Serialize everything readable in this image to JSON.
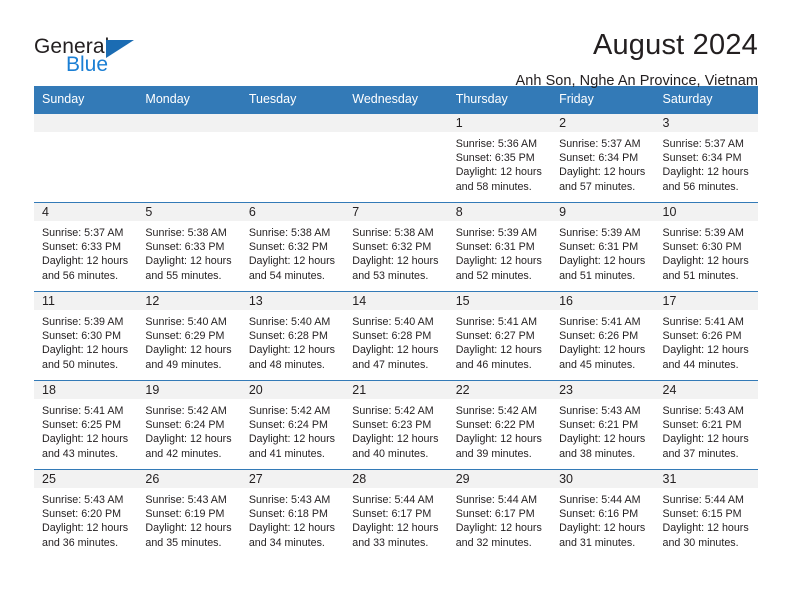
{
  "brand": {
    "name_top": "General",
    "name_bottom": "Blue",
    "accent_color": "#1b7fd4",
    "header_color": "#337ab7"
  },
  "header": {
    "title": "August 2024",
    "subtitle": "Anh Son, Nghe An Province, Vietnam"
  },
  "weekday_headers": [
    "Sunday",
    "Monday",
    "Tuesday",
    "Wednesday",
    "Thursday",
    "Friday",
    "Saturday"
  ],
  "weeks": [
    [
      {
        "day": "",
        "empty": true,
        "lines": []
      },
      {
        "day": "",
        "empty": true,
        "lines": []
      },
      {
        "day": "",
        "empty": true,
        "lines": []
      },
      {
        "day": "",
        "empty": true,
        "lines": []
      },
      {
        "day": "1",
        "empty": false,
        "lines": [
          "Sunrise: 5:36 AM",
          "Sunset: 6:35 PM",
          "Daylight: 12 hours",
          "and 58 minutes."
        ]
      },
      {
        "day": "2",
        "empty": false,
        "lines": [
          "Sunrise: 5:37 AM",
          "Sunset: 6:34 PM",
          "Daylight: 12 hours",
          "and 57 minutes."
        ]
      },
      {
        "day": "3",
        "empty": false,
        "lines": [
          "Sunrise: 5:37 AM",
          "Sunset: 6:34 PM",
          "Daylight: 12 hours",
          "and 56 minutes."
        ]
      }
    ],
    [
      {
        "day": "4",
        "empty": false,
        "lines": [
          "Sunrise: 5:37 AM",
          "Sunset: 6:33 PM",
          "Daylight: 12 hours",
          "and 56 minutes."
        ]
      },
      {
        "day": "5",
        "empty": false,
        "lines": [
          "Sunrise: 5:38 AM",
          "Sunset: 6:33 PM",
          "Daylight: 12 hours",
          "and 55 minutes."
        ]
      },
      {
        "day": "6",
        "empty": false,
        "lines": [
          "Sunrise: 5:38 AM",
          "Sunset: 6:32 PM",
          "Daylight: 12 hours",
          "and 54 minutes."
        ]
      },
      {
        "day": "7",
        "empty": false,
        "lines": [
          "Sunrise: 5:38 AM",
          "Sunset: 6:32 PM",
          "Daylight: 12 hours",
          "and 53 minutes."
        ]
      },
      {
        "day": "8",
        "empty": false,
        "lines": [
          "Sunrise: 5:39 AM",
          "Sunset: 6:31 PM",
          "Daylight: 12 hours",
          "and 52 minutes."
        ]
      },
      {
        "day": "9",
        "empty": false,
        "lines": [
          "Sunrise: 5:39 AM",
          "Sunset: 6:31 PM",
          "Daylight: 12 hours",
          "and 51 minutes."
        ]
      },
      {
        "day": "10",
        "empty": false,
        "lines": [
          "Sunrise: 5:39 AM",
          "Sunset: 6:30 PM",
          "Daylight: 12 hours",
          "and 51 minutes."
        ]
      }
    ],
    [
      {
        "day": "11",
        "empty": false,
        "lines": [
          "Sunrise: 5:39 AM",
          "Sunset: 6:30 PM",
          "Daylight: 12 hours",
          "and 50 minutes."
        ]
      },
      {
        "day": "12",
        "empty": false,
        "lines": [
          "Sunrise: 5:40 AM",
          "Sunset: 6:29 PM",
          "Daylight: 12 hours",
          "and 49 minutes."
        ]
      },
      {
        "day": "13",
        "empty": false,
        "lines": [
          "Sunrise: 5:40 AM",
          "Sunset: 6:28 PM",
          "Daylight: 12 hours",
          "and 48 minutes."
        ]
      },
      {
        "day": "14",
        "empty": false,
        "lines": [
          "Sunrise: 5:40 AM",
          "Sunset: 6:28 PM",
          "Daylight: 12 hours",
          "and 47 minutes."
        ]
      },
      {
        "day": "15",
        "empty": false,
        "lines": [
          "Sunrise: 5:41 AM",
          "Sunset: 6:27 PM",
          "Daylight: 12 hours",
          "and 46 minutes."
        ]
      },
      {
        "day": "16",
        "empty": false,
        "lines": [
          "Sunrise: 5:41 AM",
          "Sunset: 6:26 PM",
          "Daylight: 12 hours",
          "and 45 minutes."
        ]
      },
      {
        "day": "17",
        "empty": false,
        "lines": [
          "Sunrise: 5:41 AM",
          "Sunset: 6:26 PM",
          "Daylight: 12 hours",
          "and 44 minutes."
        ]
      }
    ],
    [
      {
        "day": "18",
        "empty": false,
        "lines": [
          "Sunrise: 5:41 AM",
          "Sunset: 6:25 PM",
          "Daylight: 12 hours",
          "and 43 minutes."
        ]
      },
      {
        "day": "19",
        "empty": false,
        "lines": [
          "Sunrise: 5:42 AM",
          "Sunset: 6:24 PM",
          "Daylight: 12 hours",
          "and 42 minutes."
        ]
      },
      {
        "day": "20",
        "empty": false,
        "lines": [
          "Sunrise: 5:42 AM",
          "Sunset: 6:24 PM",
          "Daylight: 12 hours",
          "and 41 minutes."
        ]
      },
      {
        "day": "21",
        "empty": false,
        "lines": [
          "Sunrise: 5:42 AM",
          "Sunset: 6:23 PM",
          "Daylight: 12 hours",
          "and 40 minutes."
        ]
      },
      {
        "day": "22",
        "empty": false,
        "lines": [
          "Sunrise: 5:42 AM",
          "Sunset: 6:22 PM",
          "Daylight: 12 hours",
          "and 39 minutes."
        ]
      },
      {
        "day": "23",
        "empty": false,
        "lines": [
          "Sunrise: 5:43 AM",
          "Sunset: 6:21 PM",
          "Daylight: 12 hours",
          "and 38 minutes."
        ]
      },
      {
        "day": "24",
        "empty": false,
        "lines": [
          "Sunrise: 5:43 AM",
          "Sunset: 6:21 PM",
          "Daylight: 12 hours",
          "and 37 minutes."
        ]
      }
    ],
    [
      {
        "day": "25",
        "empty": false,
        "lines": [
          "Sunrise: 5:43 AM",
          "Sunset: 6:20 PM",
          "Daylight: 12 hours",
          "and 36 minutes."
        ]
      },
      {
        "day": "26",
        "empty": false,
        "lines": [
          "Sunrise: 5:43 AM",
          "Sunset: 6:19 PM",
          "Daylight: 12 hours",
          "and 35 minutes."
        ]
      },
      {
        "day": "27",
        "empty": false,
        "lines": [
          "Sunrise: 5:43 AM",
          "Sunset: 6:18 PM",
          "Daylight: 12 hours",
          "and 34 minutes."
        ]
      },
      {
        "day": "28",
        "empty": false,
        "lines": [
          "Sunrise: 5:44 AM",
          "Sunset: 6:17 PM",
          "Daylight: 12 hours",
          "and 33 minutes."
        ]
      },
      {
        "day": "29",
        "empty": false,
        "lines": [
          "Sunrise: 5:44 AM",
          "Sunset: 6:17 PM",
          "Daylight: 12 hours",
          "and 32 minutes."
        ]
      },
      {
        "day": "30",
        "empty": false,
        "lines": [
          "Sunrise: 5:44 AM",
          "Sunset: 6:16 PM",
          "Daylight: 12 hours",
          "and 31 minutes."
        ]
      },
      {
        "day": "31",
        "empty": false,
        "lines": [
          "Sunrise: 5:44 AM",
          "Sunset: 6:15 PM",
          "Daylight: 12 hours",
          "and 30 minutes."
        ]
      }
    ]
  ]
}
